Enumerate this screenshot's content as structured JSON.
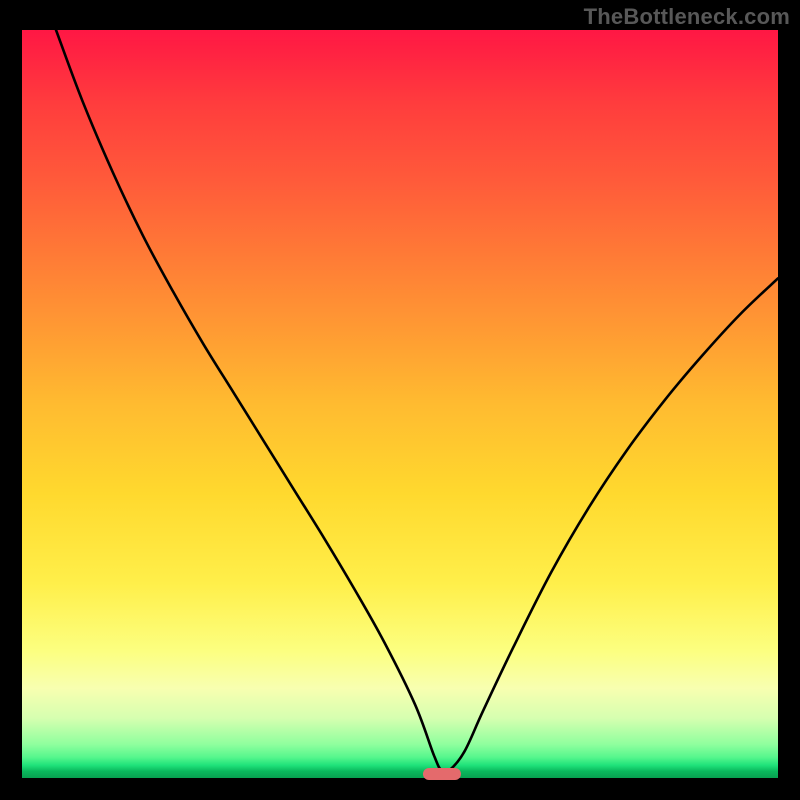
{
  "attribution": "TheBottleneck.com",
  "chart_data": {
    "type": "line",
    "title": "",
    "xlabel": "",
    "ylabel": "",
    "xlim": [
      0,
      1
    ],
    "ylim": [
      0,
      1
    ],
    "series": [
      {
        "name": "curve",
        "x": [
          0.045,
          0.08,
          0.12,
          0.16,
          0.2,
          0.24,
          0.28,
          0.32,
          0.36,
          0.4,
          0.44,
          0.48,
          0.52,
          0.545,
          0.555,
          0.565,
          0.585,
          0.61,
          0.65,
          0.7,
          0.75,
          0.8,
          0.85,
          0.9,
          0.95,
          1.0
        ],
        "y": [
          1.0,
          0.905,
          0.81,
          0.725,
          0.65,
          0.58,
          0.515,
          0.45,
          0.385,
          0.32,
          0.252,
          0.18,
          0.098,
          0.03,
          0.01,
          0.01,
          0.035,
          0.09,
          0.175,
          0.275,
          0.362,
          0.438,
          0.505,
          0.565,
          0.62,
          0.668
        ]
      }
    ],
    "marker": {
      "x": 0.555,
      "y": 0.005
    },
    "gradient_stops": [
      {
        "pos": 0.0,
        "color": "#ff1744"
      },
      {
        "pos": 0.5,
        "color": "#ffd92e"
      },
      {
        "pos": 0.88,
        "color": "#f8ffb0"
      },
      {
        "pos": 1.0,
        "color": "#08a050"
      }
    ]
  }
}
